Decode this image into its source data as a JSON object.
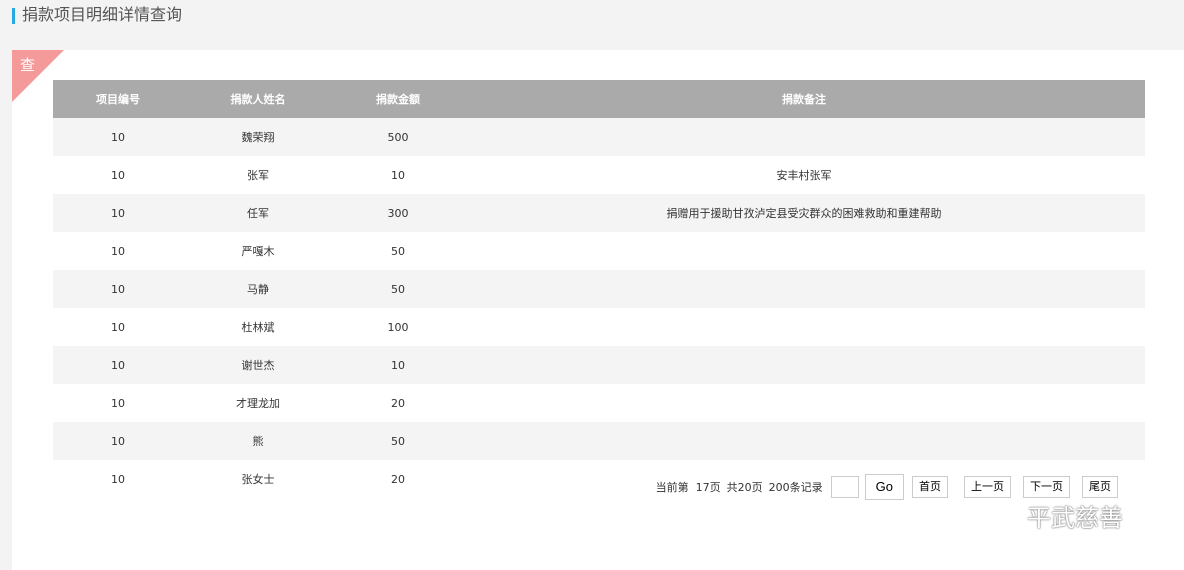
{
  "header": {
    "title": "捐款项目明细详情查询"
  },
  "panel": {
    "ribbon_label": "查"
  },
  "table": {
    "columns": [
      "项目编号",
      "捐款人姓名",
      "捐款金额",
      "捐款备注"
    ],
    "rows": [
      {
        "project_id": "10",
        "donor": "魏荣翔",
        "amount": "500",
        "note": ""
      },
      {
        "project_id": "10",
        "donor": "张军",
        "amount": "10",
        "note": "安丰村张军"
      },
      {
        "project_id": "10",
        "donor": "任军",
        "amount": "300",
        "note": "捐赠用于援助甘孜泸定县受灾群众的困难救助和重建帮助"
      },
      {
        "project_id": "10",
        "donor": "严嘎木",
        "amount": "50",
        "note": ""
      },
      {
        "project_id": "10",
        "donor": "马静",
        "amount": "50",
        "note": ""
      },
      {
        "project_id": "10",
        "donor": "杜林斌",
        "amount": "100",
        "note": ""
      },
      {
        "project_id": "10",
        "donor": "谢世杰",
        "amount": "10",
        "note": ""
      },
      {
        "project_id": "10",
        "donor": "才理龙加",
        "amount": "20",
        "note": ""
      },
      {
        "project_id": "10",
        "donor": "熊",
        "amount": "50",
        "note": ""
      },
      {
        "project_id": "10",
        "donor": "张女士",
        "amount": "20",
        "note": ""
      }
    ]
  },
  "pager": {
    "current": "当前第  17页",
    "total_pages": "共20页",
    "total_records": "200条记录",
    "jump_value": "",
    "go_label": "Go",
    "first_label": "首页",
    "prev_label": "上一页",
    "next_label": "下一页",
    "last_label": "尾页"
  },
  "watermark": {
    "text": "平武慈善",
    "icon": "wechat-icon"
  },
  "colors": {
    "accent": "#29a9e1",
    "ribbon": "#f49a9a",
    "table_header": "#aaaaaa",
    "stripe": "#f4f4f4"
  }
}
